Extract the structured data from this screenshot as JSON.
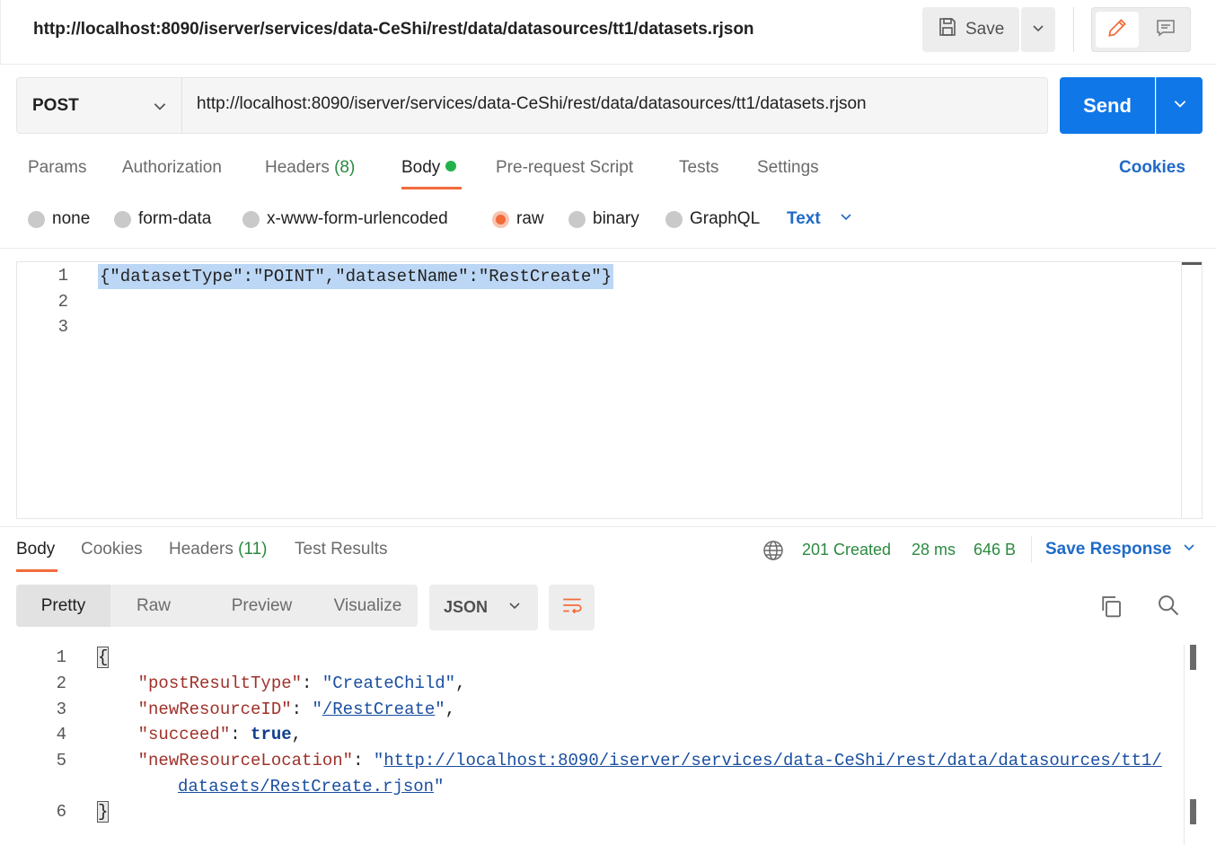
{
  "request": {
    "title": "http://localhost:8090/iserver/services/data-CeShi/rest/data/datasources/tt1/datasets.rjson",
    "save_label": "Save",
    "method": "POST",
    "url": "http://localhost:8090/iserver/services/data-CeShi/rest/data/datasources/tt1/datasets.rjson",
    "send_label": "Send"
  },
  "request_tabs": {
    "params": "Params",
    "authorization": "Authorization",
    "headers": "Headers",
    "headers_count": "(8)",
    "body": "Body",
    "pre_request": "Pre-request Script",
    "tests": "Tests",
    "settings": "Settings",
    "cookies": "Cookies"
  },
  "body_types": {
    "none": "none",
    "form_data": "form-data",
    "urlencoded": "x-www-form-urlencoded",
    "raw": "raw",
    "binary": "binary",
    "graphql": "GraphQL",
    "selected": "raw",
    "raw_format": "Text"
  },
  "request_body": {
    "line_numbers": [
      "1",
      "2",
      "3"
    ],
    "line1": "{\"datasetType\":\"POINT\",\"datasetName\":\"RestCreate\"}"
  },
  "response_tabs": {
    "body": "Body",
    "cookies": "Cookies",
    "headers": "Headers",
    "headers_count": "(11)",
    "test_results": "Test Results"
  },
  "response_status": {
    "status": "201 Created",
    "time": "28 ms",
    "size": "646 B",
    "save_response": "Save Response"
  },
  "response_view": {
    "modes": [
      "Pretty",
      "Raw",
      "Preview",
      "Visualize"
    ],
    "format": "JSON"
  },
  "response_body": {
    "line_numbers": [
      "1",
      "2",
      "3",
      "4",
      "5",
      "6"
    ],
    "open_brace": "{",
    "close_brace": "}",
    "k1": "\"postResultType\"",
    "v1": "\"CreateChild\"",
    "k2": "\"newResourceID\"",
    "v2": "/RestCreate",
    "k3": "\"succeed\"",
    "v3": "true",
    "k4": "\"newResourceLocation\"",
    "v4a": "http://localhost:8090/iserver/services/data-CeShi/rest/data/datasources/tt1/",
    "v4b": "datasets/RestCreate.rjson"
  },
  "colors": {
    "accent": "#f26b3a",
    "send": "#0f77e8",
    "link": "#1f6ac7",
    "success": "#2a8a3f"
  },
  "icons": [
    "save-icon",
    "chevron-down-icon",
    "pencil-icon",
    "comment-icon",
    "globe-icon",
    "wrap-lines-icon",
    "copy-icon",
    "search-icon"
  ]
}
